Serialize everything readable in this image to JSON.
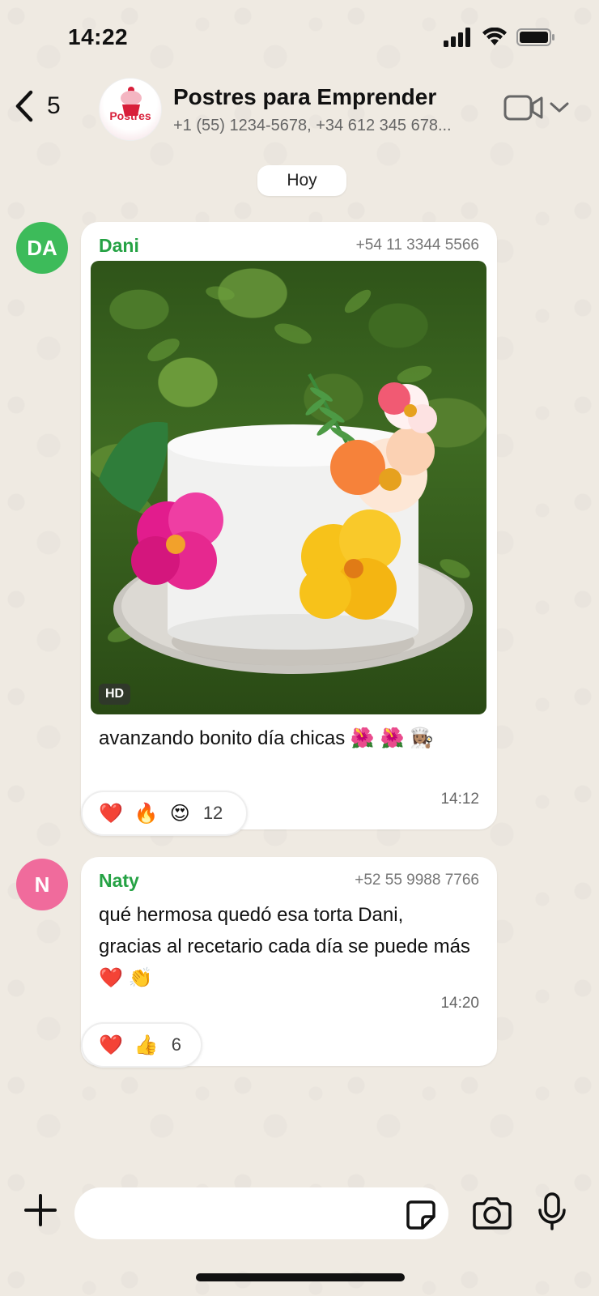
{
  "status_bar": {
    "time": "14:22"
  },
  "header": {
    "back_count": "5",
    "group_name": "Postres para Emprender",
    "group_members": "+1 (55) 1234-5678, +34 612 345 678...",
    "avatar_brand": "Postres"
  },
  "date_chip": "Hoy",
  "messages": [
    {
      "avatar_initials": "DA",
      "avatar_color": "#3dbb5a",
      "sender": "Dani",
      "phone": "+54 11 3344 5566",
      "hd_badge": "HD",
      "caption": "avanzando bonito día chicas 🌺 🌺 👩🏽‍🍳",
      "time": "14:12",
      "reactions": {
        "emojis": [
          "❤️",
          "🔥",
          "😍"
        ],
        "count": "12"
      }
    },
    {
      "avatar_initials": "N",
      "avatar_color": "#f06b9c",
      "sender": "Naty",
      "phone": "+52 55 9988 7766",
      "text": "qué hermosa quedó esa torta Dani, gracias al recetario cada día se puede más ❤️ 👏",
      "time": "14:20",
      "reactions": {
        "emojis": [
          "❤️",
          "👍"
        ],
        "count": "6"
      }
    }
  ],
  "input": {
    "placeholder": ""
  },
  "colors": {
    "sender_green": "#25a244",
    "background": "#efeae2"
  },
  "icons": [
    "back-icon",
    "signal-icon",
    "wifi-icon",
    "battery-icon",
    "video-call-icon",
    "chevron-down-icon",
    "plus-icon",
    "sticker-icon",
    "camera-icon",
    "mic-icon"
  ]
}
